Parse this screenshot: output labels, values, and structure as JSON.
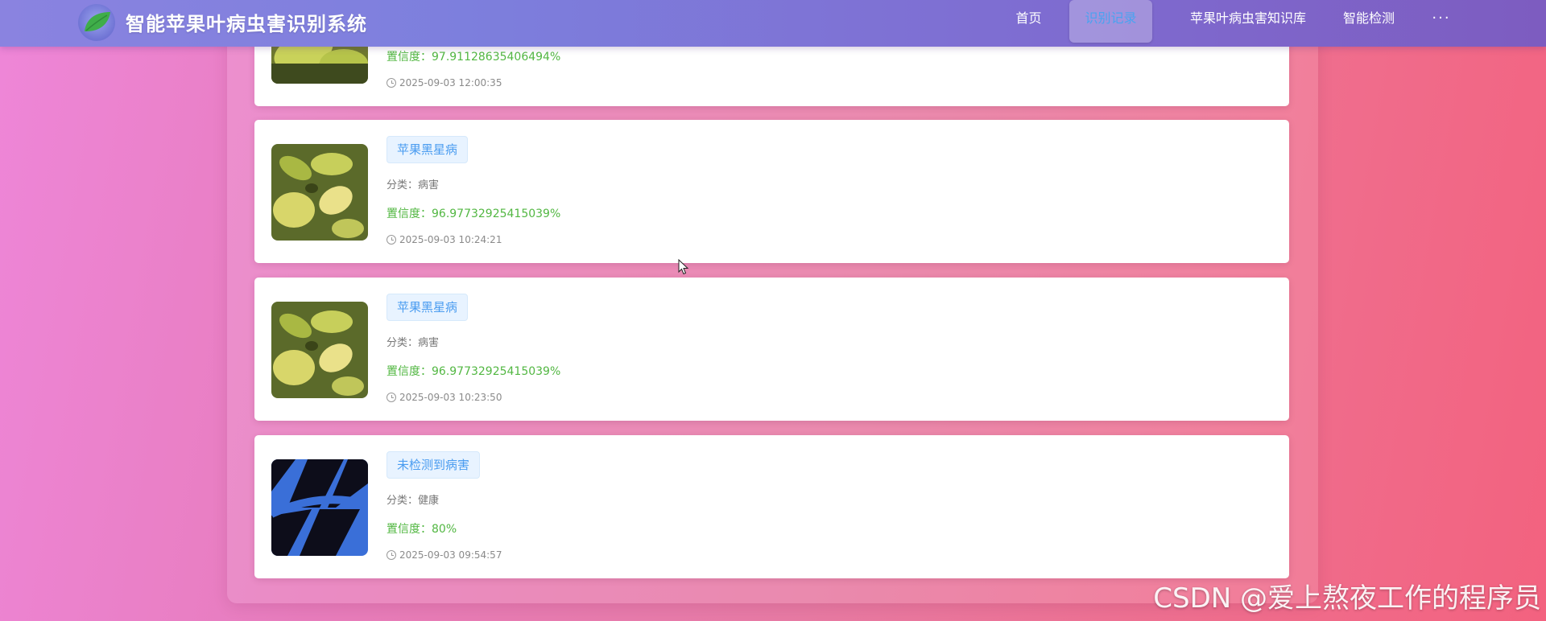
{
  "header": {
    "title": "智能苹果叶病虫害识别系统",
    "nav": [
      {
        "label": "首页"
      },
      {
        "label": "识别记录"
      },
      {
        "label": "苹果叶病虫害知识库"
      },
      {
        "label": "智能检测"
      },
      {
        "label": "···"
      }
    ]
  },
  "records": [
    {
      "confidence": "置信度：97.91128635406494%",
      "time": "2025-09-03 12:00:35"
    },
    {
      "tag": "苹果黑星病",
      "category": "分类：病害",
      "confidence": "置信度：96.97732925415039%",
      "time": "2025-09-03 10:24:21"
    },
    {
      "tag": "苹果黑星病",
      "category": "分类：病害",
      "confidence": "置信度：96.97732925415039%",
      "time": "2025-09-03 10:23:50"
    },
    {
      "tag": "未检测到病害",
      "category": "分类：健康",
      "confidence": "置信度：80%",
      "time": "2025-09-03 09:54:57"
    }
  ],
  "watermark": "CSDN @爱上熬夜工作的程序员",
  "colors": {
    "tag_text": "#4a9cf0",
    "confidence": "#52b742",
    "header": "#7d7fdd"
  },
  "icons": {
    "logo": "leaf-icon",
    "time": "clock-icon"
  }
}
